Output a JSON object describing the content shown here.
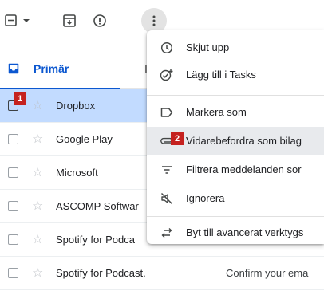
{
  "toolbar": {
    "select_icon": "checkbox-dropdown-icon",
    "archive_icon": "archive-icon",
    "report_icon": "report-spam-icon",
    "more_icon": "more-vert-icon"
  },
  "tabs": {
    "primary_label": "Primär",
    "secondary_partial": "I"
  },
  "emails": [
    {
      "sender": "Dropbox",
      "snippet": "",
      "selected": true
    },
    {
      "sender": "Google Play",
      "snippet": "",
      "selected": false
    },
    {
      "sender": "Microsoft",
      "snippet": "",
      "selected": false
    },
    {
      "sender": "ASCOMP Softwar",
      "snippet": "",
      "selected": false
    },
    {
      "sender": "Spotify for Podca",
      "snippet": "",
      "selected": false
    },
    {
      "sender": "Spotify for Podcast.",
      "snippet": "Confirm your ema",
      "selected": false
    }
  ],
  "menu": {
    "items": [
      {
        "label": "Skjut upp",
        "icon": "clock-icon"
      },
      {
        "label": "Lägg till i Tasks",
        "icon": "add-task-icon"
      },
      {
        "label": "Markera som",
        "icon": "label-icon"
      },
      {
        "label": "Vidarebefordra som bilag",
        "icon": "forward-attachment-icon"
      },
      {
        "label": "Filtrera meddelanden sor",
        "icon": "filter-icon"
      },
      {
        "label": "Ignorera",
        "icon": "mute-icon"
      },
      {
        "label": "Byt till avancerat verktygs",
        "icon": "switch-toolbar-icon"
      }
    ]
  },
  "badges": {
    "one": "1",
    "two": "2"
  },
  "colors": {
    "accent": "#0b57d0",
    "selected_row": "#c2dbff",
    "badge": "#c5221f"
  }
}
